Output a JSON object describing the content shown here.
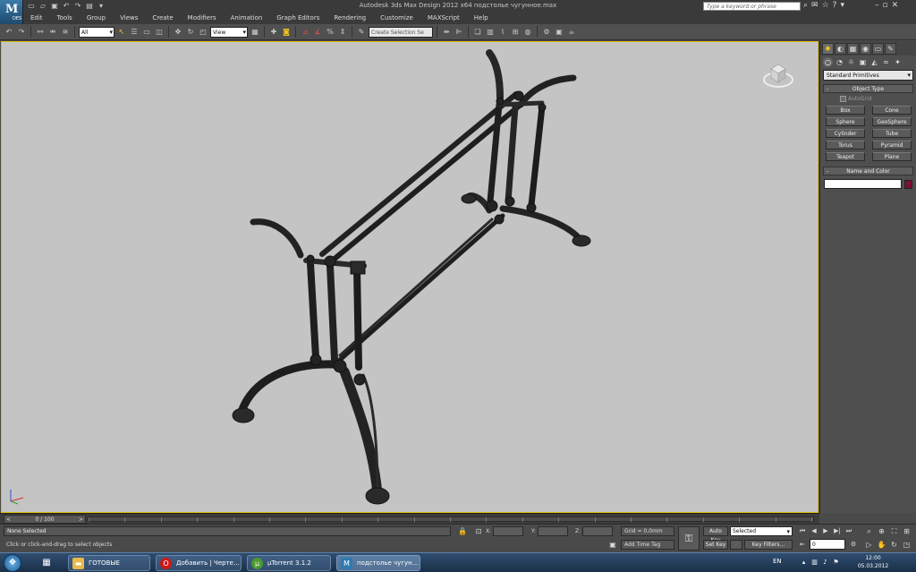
{
  "titlebar": {
    "title": "Autodesk 3ds Max Design 2012 x64     подстолье чугунное.max",
    "logo_text": "M",
    "logo_badge": "DES",
    "search_placeholder": "Type a keyword or phrase"
  },
  "menu": [
    "Edit",
    "Tools",
    "Group",
    "Views",
    "Create",
    "Modifiers",
    "Animation",
    "Graph Editors",
    "Rendering",
    "Customize",
    "MAXScript",
    "Help"
  ],
  "toolbar": {
    "selection_filter": "All",
    "ref_coord": "View",
    "named_selection_placeholder": "Create Selection Se"
  },
  "command_panel": {
    "category": "Standard Primitives",
    "rollout_object_type": "Object Type",
    "autogrid": "AutoGrid",
    "objects": [
      "Box",
      "Cone",
      "Sphere",
      "GeoSphere",
      "Cylinder",
      "Tube",
      "Torus",
      "Pyramid",
      "Teapot",
      "Plane"
    ],
    "rollout_name_color": "Name and Color",
    "swatch_color": "#7a1238"
  },
  "timeline": {
    "frame_display": "0 / 100"
  },
  "status": {
    "selection": "None Selected",
    "prompt": "Click or click-and-drag to select objects",
    "x_label": "X:",
    "y_label": "Y:",
    "z_label": "Z:",
    "grid": "Grid = 0,0mm",
    "add_time_tag": "Add Time Tag",
    "auto_key": "Auto Key",
    "set_key": "Set Key",
    "selected_option": "Selected",
    "key_filters": "Key Filters...",
    "frame_value": "0"
  },
  "taskbar": {
    "items": [
      {
        "label": "ГОТОВЫЕ"
      },
      {
        "label": "Добавить | Черте..."
      },
      {
        "label": "µTorrent 3.1.2"
      },
      {
        "label": "подстолье чугун..."
      }
    ],
    "lang": "EN",
    "time": "12:00",
    "date": "05.03.2012"
  }
}
